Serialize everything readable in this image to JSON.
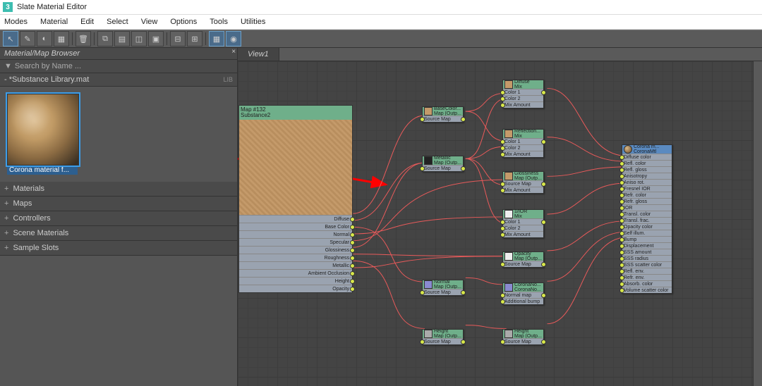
{
  "title": "Slate Material Editor",
  "menubar": [
    "Modes",
    "Material",
    "Edit",
    "Select",
    "View",
    "Options",
    "Tools",
    "Utilities"
  ],
  "browser": {
    "header": "Material/Map Browser",
    "search_placeholder": "Search by Name ...",
    "library": {
      "name": "*Substance Library.mat",
      "tag": "LIB"
    },
    "thumb_label": "Corona material f...",
    "tree": [
      "Materials",
      "Maps",
      "Controllers",
      "Scene Materials",
      "Sample Slots"
    ]
  },
  "view_tab": "View1",
  "nodes": {
    "substance": {
      "title1": "Map #132",
      "title2": "Substance2",
      "outputs": [
        "Diffuse",
        "Base Color",
        "Normal",
        "Specular",
        "Glossiness",
        "Roughness",
        "Metallic",
        "Ambient Occlusion",
        "Height",
        "Opacity"
      ]
    },
    "basecolor": {
      "t1": "BaseColor...",
      "t2": "Map (Outp...",
      "rows": [
        "Source Map"
      ]
    },
    "metallic": {
      "t1": "Metallic",
      "t2": "Map (Outp...",
      "rows": [
        "Source Map"
      ]
    },
    "normal": {
      "t1": "Normal",
      "t2": "Map (Outp...",
      "rows": [
        "Source Map"
      ]
    },
    "height": {
      "t1": "Height",
      "t2": "Map (Outp...",
      "rows": [
        "Source Map"
      ]
    },
    "diffuse": {
      "t1": "Diffuse",
      "t2": "Mix",
      "rows": [
        "Color 1",
        "Color 2",
        "Mix Amount"
      ]
    },
    "reflection": {
      "t1": "Reflection...",
      "t2": "Mix",
      "rows": [
        "Color 1",
        "Color 2",
        "Mix Amount"
      ]
    },
    "glossiness": {
      "t1": "Glossiness",
      "t2": "Map (Outp...",
      "rows": [
        "Source Map",
        "Mix Amount"
      ]
    },
    "ior": {
      "t1": "1/IOR",
      "t2": "Mix",
      "rows": [
        "Color 1",
        "Color 2",
        "Mix Amount"
      ]
    },
    "opacity": {
      "t1": "Opacity",
      "t2": "Map (Outp...",
      "rows": [
        "Source Map"
      ]
    },
    "coronano": {
      "t1": "CoronaNo...",
      "t2": "CoronaNo...",
      "rows": [
        "Normal map",
        "Additional bump"
      ]
    },
    "corona": {
      "t1": "Corona m...",
      "t2": "CoronaMtl",
      "rows": [
        "Diffuse color",
        "Refl. color",
        "Refl. gloss",
        "Anisotropy",
        "Aniso rot.",
        "Fresnel IOR",
        "Refr. color",
        "Refr. gloss",
        "IOR",
        "Transl. color",
        "Transl. frac.",
        "Opacity color",
        "Self illum.",
        "Bump",
        "Displacement",
        "SSS amount",
        "SSS radius",
        "SSS scatter color",
        "Refl. env.",
        "Refr. env.",
        "Absorb. color",
        "Volume scatter color"
      ]
    }
  }
}
